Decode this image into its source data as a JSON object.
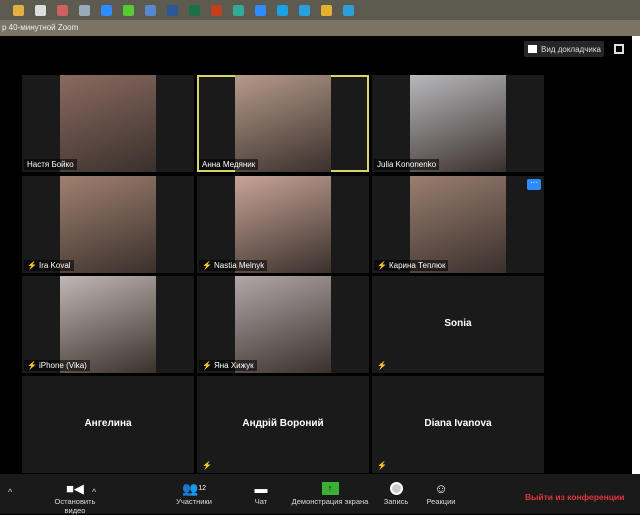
{
  "taskbar": {
    "icons": [
      "file-explorer",
      "calculator",
      "paint",
      "notepad",
      "teamviewer",
      "utorrent",
      "antivirus",
      "word",
      "excel",
      "powerpoint",
      "edge",
      "zoom",
      "skype",
      "telegram",
      "chrome",
      "telegram-2"
    ]
  },
  "window": {
    "title": "р 40-минутной Zoom"
  },
  "view": {
    "speaker_view_label": "Вид докладчика"
  },
  "participants": [
    {
      "name": "Настя Бойко",
      "muted": false,
      "video": true,
      "color": "#8a6a60"
    },
    {
      "name": "Анна Медяник",
      "muted": false,
      "video": true,
      "active": true,
      "color": "#b59a8a"
    },
    {
      "name": "Julia Kononenko",
      "muted": false,
      "video": true,
      "color": "#b8b8bc"
    },
    {
      "name": "Ira Koval",
      "muted": true,
      "video": true,
      "color": "#a08070"
    },
    {
      "name": "Nastia Melnyk",
      "muted": true,
      "video": true,
      "color": "#c8a498"
    },
    {
      "name": "Карина Теплюк",
      "muted": true,
      "video": true,
      "color": "#9a7e70"
    },
    {
      "name": "iPhone (Vika)",
      "muted": true,
      "video": true,
      "color": "#c0b8b4"
    },
    {
      "name": "Яна Хижук",
      "muted": true,
      "video": true,
      "color": "#b0a8a8"
    },
    {
      "name": "Sonia",
      "muted": true,
      "video": false
    },
    {
      "name": "Ангелина",
      "muted": false,
      "video": false
    },
    {
      "name": "Андрій Вороний",
      "muted": true,
      "video": false
    },
    {
      "name": "Diana Ivanova",
      "muted": true,
      "video": false
    }
  ],
  "toolbar": {
    "stop_video": "Остановить видео",
    "participants": "Участники",
    "participants_count": "12",
    "chat": "Чат",
    "share_screen": "Демонстрация экрана",
    "record": "Запись",
    "reactions": "Реакции",
    "leave": "Выйти из конференции"
  }
}
